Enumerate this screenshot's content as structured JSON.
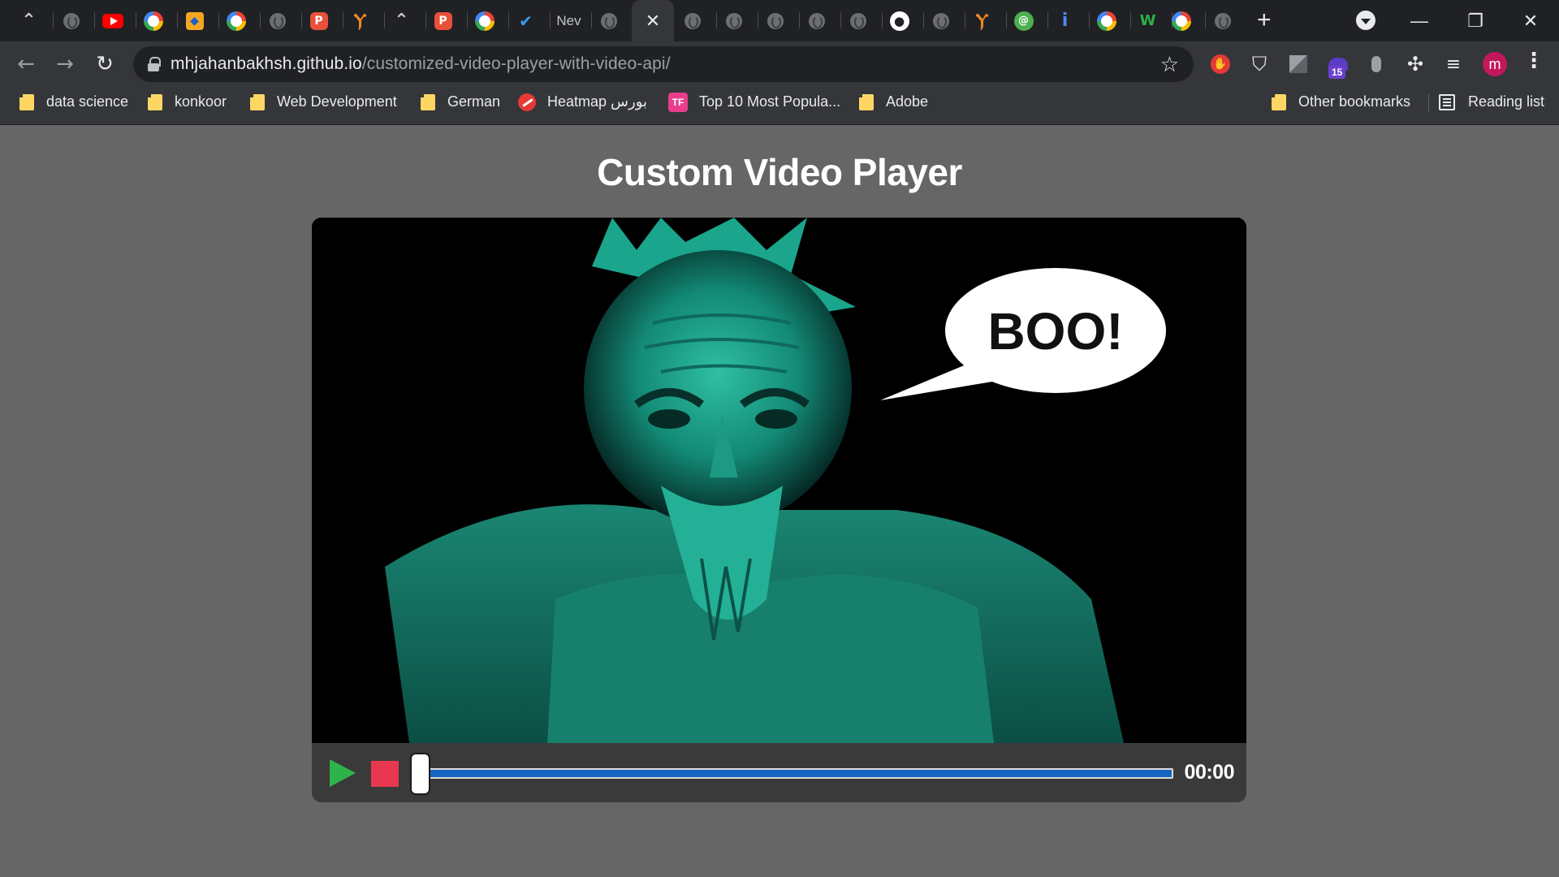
{
  "browser": {
    "tabs": [
      {
        "icon": "arch-icon"
      },
      {
        "icon": "globe-icon"
      },
      {
        "icon": "youtube-icon"
      },
      {
        "icon": "google-icon"
      },
      {
        "icon": "book-icon"
      },
      {
        "icon": "google-icon"
      },
      {
        "icon": "globe-icon"
      },
      {
        "icon": "p-icon"
      },
      {
        "icon": "fire-icon"
      },
      {
        "icon": "arch-icon"
      },
      {
        "icon": "p-icon"
      },
      {
        "icon": "google-icon"
      },
      {
        "icon": "bird-icon"
      },
      {
        "icon": "new-tab-text",
        "text": "Nev"
      },
      {
        "icon": "globe-icon"
      },
      {
        "icon": "close-icon",
        "active": true
      },
      {
        "icon": "globe-icon"
      },
      {
        "icon": "globe-icon"
      },
      {
        "icon": "globe-icon"
      },
      {
        "icon": "globe-icon"
      },
      {
        "icon": "globe-icon"
      },
      {
        "icon": "github-icon"
      },
      {
        "icon": "globe-icon"
      },
      {
        "icon": "fire-icon"
      },
      {
        "icon": "green-circle-icon"
      },
      {
        "icon": "info-icon"
      },
      {
        "icon": "google-icon"
      },
      {
        "icon": "w-icon"
      },
      {
        "icon": "google-icon"
      },
      {
        "icon": "globe-icon"
      }
    ],
    "partial_tab_text": "Nev",
    "url_host": "mhjahanbakhsh.github.io",
    "url_path": "/customized-video-player-with-video-api/",
    "extension_badge": "15",
    "profile_initial": "m",
    "bookmarks": [
      {
        "label": "data science",
        "icon": "folder-icon"
      },
      {
        "label": "konkoor",
        "icon": "folder-icon"
      },
      {
        "label": "Web Development",
        "icon": "folder-icon"
      },
      {
        "label": "German",
        "icon": "folder-icon"
      },
      {
        "label": "Heatmap بورس",
        "icon": "heatmap-icon"
      },
      {
        "label": "Top 10 Most Popula...",
        "icon": "tf-icon"
      },
      {
        "label": "Adobe",
        "icon": "folder-icon"
      }
    ],
    "other_bookmarks": "Other bookmarks",
    "reading_list": "Reading list"
  },
  "page": {
    "title": "Custom Video Player",
    "video": {
      "speech_bubble_text": "BOO!"
    },
    "controls": {
      "time": "00:00",
      "progress_fraction": 0,
      "colors": {
        "play": "#2eb34a",
        "stop": "#e8384f",
        "progress": "#1565c0"
      }
    }
  }
}
